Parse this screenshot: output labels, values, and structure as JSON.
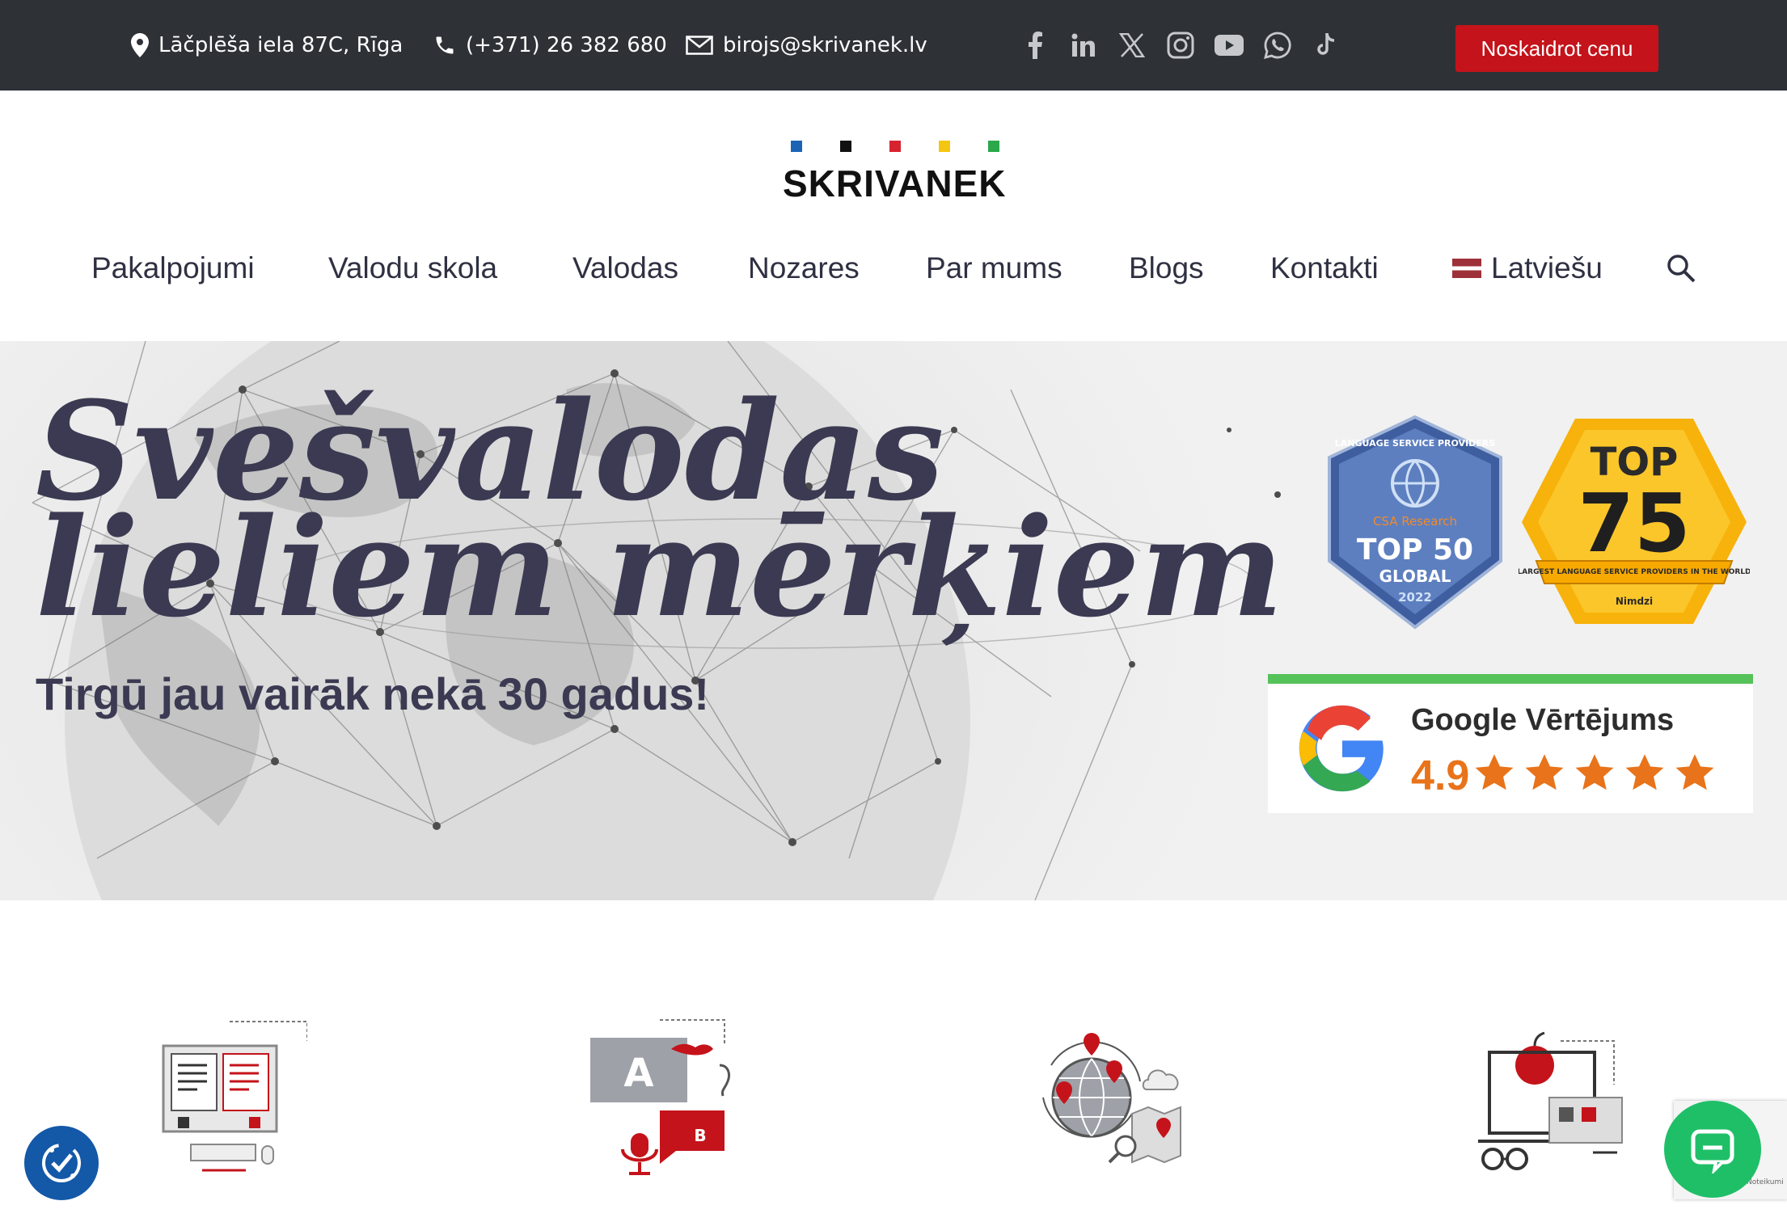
{
  "topbar": {
    "address": "Lāčplēša iela 87C, Rīga",
    "phone": "(+371) 26 382 680",
    "email": "birojs@skrivanek.lv",
    "social_icons": [
      "facebook-icon",
      "linkedin-icon",
      "x-icon",
      "instagram-icon",
      "youtube-icon",
      "whatsapp-icon",
      "tiktok-icon"
    ],
    "cta_label": "Noskaidrot cenu"
  },
  "logo": {
    "text": "SKRIVANEK",
    "dot_colors": [
      "#1b63b5",
      "#111111",
      "#d7232f",
      "#f4c611",
      "#2aa84a"
    ]
  },
  "nav": {
    "items": [
      "Pakalpojumi",
      "Valodu skola",
      "Valodas",
      "Nozares",
      "Par mums",
      "Blogs",
      "Kontakti"
    ],
    "language": "Latviešu"
  },
  "hero": {
    "headline_line1": "Svešvalodas",
    "headline_line2": "lieliem mērķiem",
    "subheadline": "Tirgū jau vairāk nekā 30 gadus!",
    "badge_csa": {
      "arc": "LANGUAGE SERVICE PROVIDERS",
      "brand": "CSA Research",
      "main": "TOP 50",
      "sub": "GLOBAL",
      "year": "2022"
    },
    "badge_nimdzi": {
      "top": "TOP",
      "number": "75",
      "ribbon": "LARGEST LANGUAGE SERVICE PROVIDERS IN THE WORLD",
      "brand": "Nimdzi"
    },
    "google": {
      "title": "Google Vērtējums",
      "rating": "4.9",
      "stars": 5
    }
  },
  "features": {
    "icons": [
      "translation-icon",
      "interpreting-icon",
      "localization-icon",
      "language-school-icon"
    ]
  },
  "widgets": {
    "recaptcha_text": "Noteikumi"
  },
  "colors": {
    "topbar": "#2e3237",
    "cta": "#c4131a",
    "text": "#3b3a52",
    "chat": "#1fbf68",
    "accessibility": "#1458a8"
  }
}
